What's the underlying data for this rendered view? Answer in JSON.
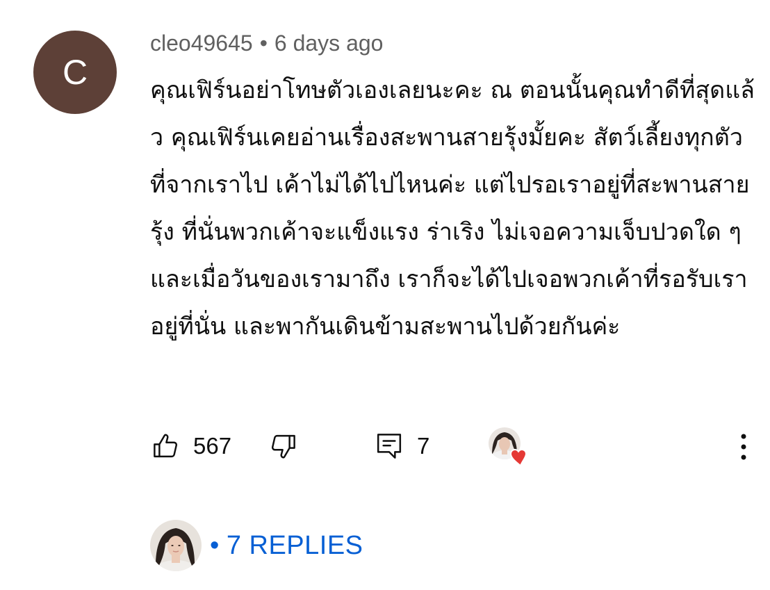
{
  "comment": {
    "avatar_letter": "C",
    "author": "cleo49645",
    "separator": "•",
    "time_ago": "6 days ago",
    "text": "คุณเฟิร์นอย่าโทษตัวเองเลยนะคะ ณ ตอนนั้นคุณทำดีที่สุดแล้ว คุณเฟิร์นเคยอ่านเรื่องสะพานสายรุ้งมั้ยคะ สัตว์เลี้ยงทุกตัวที่จากเราไป เค้าไม่ได้ไปไหนค่ะ แต่ไปรอเราอยู่ที่สะพานสายรุ้ง ที่นั่นพวกเค้าจะแข็งแรง ร่าเริง ไม่เจอความเจ็บปวดใด ๆ และเมื่อวันของเรามาถึง เราก็จะได้ไปเจอพวกเค้าที่รอรับเราอยู่ที่นั่น และพากันเดินข้ามสะพานไปด้วยกันค่ะ"
  },
  "actions": {
    "like_count": "567",
    "reply_count": "7"
  },
  "replies": {
    "dot": "•",
    "label": "7 REPLIES"
  },
  "colors": {
    "avatar_bg": "#5d4037",
    "meta_text": "#606060",
    "link_blue": "#065fd4",
    "heart_red": "#e53935"
  },
  "icons": {
    "like": "thumb-up-icon",
    "dislike": "thumb-down-icon",
    "reply": "comment-icon",
    "creator_heart": "creator-heart-icon",
    "more": "more-vert-icon"
  }
}
